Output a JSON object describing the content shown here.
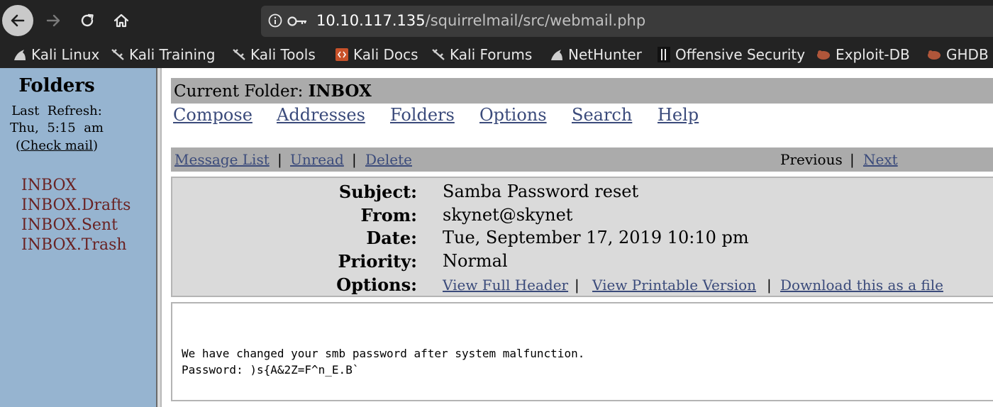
{
  "browser": {
    "url_host": "10.10.117.135",
    "url_path": "/squirrelmail/src/webmail.php",
    "bookmarks": [
      {
        "label": "Kali Linux",
        "icon": "kali-dragon-icon"
      },
      {
        "label": "Kali Training",
        "icon": "kali-dragon-icon"
      },
      {
        "label": "Kali Tools",
        "icon": "kali-dragon-icon"
      },
      {
        "label": "Kali Docs",
        "icon": "docs-icon"
      },
      {
        "label": "Kali Forums",
        "icon": "kali-dragon-icon"
      },
      {
        "label": "NetHunter",
        "icon": "kali-dragon-icon"
      },
      {
        "label": "Offensive Security",
        "icon": "offsec-icon"
      },
      {
        "label": "Exploit-DB",
        "icon": "exploit-db-icon"
      },
      {
        "label": "GHDB",
        "icon": "exploit-db-icon"
      }
    ]
  },
  "sidebar": {
    "title": "Folders",
    "refresh_label": "Last  Refresh:",
    "refresh_time": "Thu,  5:15  am",
    "check_mail_open": "(",
    "check_mail": "Check mail",
    "check_mail_close": ")",
    "folders": [
      "INBOX",
      "INBOX.Drafts",
      "INBOX.Sent",
      "INBOX.Trash"
    ]
  },
  "main": {
    "current_folder_label": "Current Folder: ",
    "current_folder": "INBOX",
    "nav": [
      "Compose",
      "Addresses",
      "Folders",
      "Options",
      "Search",
      "Help"
    ],
    "message_nav": {
      "message_list": "Message List",
      "unread": "Unread",
      "delete": "Delete",
      "previous": "Previous",
      "next": "Next",
      "separator": "|"
    },
    "headers": {
      "subject_label": "Subject:",
      "subject": "Samba Password reset",
      "from_label": "From:",
      "from": "skynet@skynet",
      "date_label": "Date:",
      "date": "Tue, September 17, 2019 10:10 pm",
      "priority_label": "Priority:",
      "priority": "Normal",
      "options_label": "Options:",
      "options": [
        "View Full Header",
        "View Printable Version",
        "Download this as a file"
      ]
    },
    "body_lines": [
      "We have changed your smb password after system malfunction.",
      "Password: )s{A&2Z=F^n_E.B`"
    ]
  },
  "colors": {
    "sidebar_bg": "#96b4d0",
    "link": "#3b4b7b",
    "folder_link": "#6a2222",
    "bar_gray": "#ababab",
    "header_bg": "#dadada"
  }
}
